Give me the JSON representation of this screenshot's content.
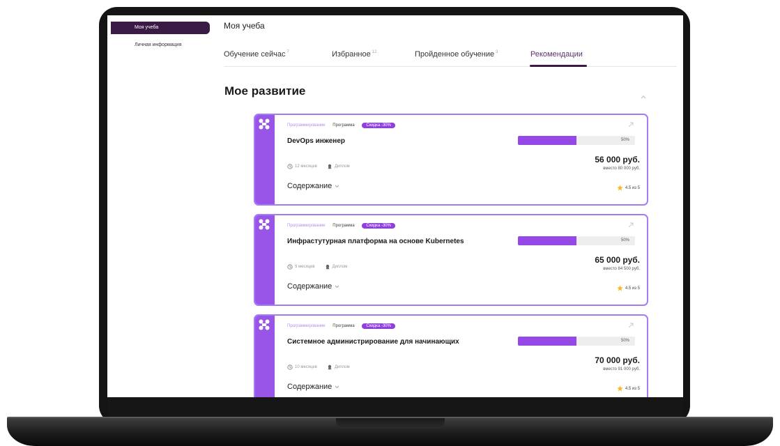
{
  "sidebar": {
    "items": [
      {
        "label": "Моя учеба",
        "active": true
      },
      {
        "label": "Личная информация",
        "active": false
      }
    ]
  },
  "header": {
    "title": "Моя учеба"
  },
  "tabs": [
    {
      "label": "Обучение сейчас",
      "count": "7"
    },
    {
      "label": "Избранное",
      "count": "12"
    },
    {
      "label": "Пройденное обучение",
      "count": "3"
    },
    {
      "label": "Рекомендации",
      "count": "",
      "active": true
    }
  ],
  "section": {
    "title": "Мое развитие"
  },
  "cards": [
    {
      "category": "Программирование",
      "type": "Программа",
      "discount": "Скидка -30%",
      "title": "DevOps инженер",
      "progress": 0.5,
      "progress_label": "50%",
      "price": "56 000 руб.",
      "old_price": "вместо 80 000 руб.",
      "duration": "12 месяцев",
      "certificate": "Диплом",
      "contents_label": "Содержание",
      "rating": "4.5 из 5"
    },
    {
      "category": "Программирование",
      "type": "Программа",
      "discount": "Скидка -30%",
      "title": "Инфрастутурная платформа на основе Kubernetes",
      "progress": 0.5,
      "progress_label": "50%",
      "price": "65 000 руб.",
      "old_price": "вместо 84 500 руб.",
      "duration": "9 месяцев",
      "certificate": "Диплом",
      "contents_label": "Содержание",
      "rating": "4.5 из 5"
    },
    {
      "category": "Программирование",
      "type": "Программа",
      "discount": "Скидка -30%",
      "title": "Системное администрирование для начинающих",
      "progress": 0.5,
      "progress_label": "50%",
      "price": "70 000 руб.",
      "old_price": "вместо 91 000 руб.",
      "duration": "10 месяцев",
      "certificate": "Диплом",
      "contents_label": "Содержание",
      "rating": "4.5 из 5"
    }
  ],
  "icons": {
    "card_logo": "course-logo-icon",
    "external": "external-link-icon",
    "clock": "clock-icon",
    "diploma": "diploma-icon",
    "chevron": "chevron-down-icon",
    "star": "star-icon",
    "collapse": "chevron-up-icon"
  },
  "colors": {
    "accent": "#9955e8",
    "border": "#a57af4",
    "sidebar_active": "#3b1b46",
    "star": "#f5b820"
  }
}
